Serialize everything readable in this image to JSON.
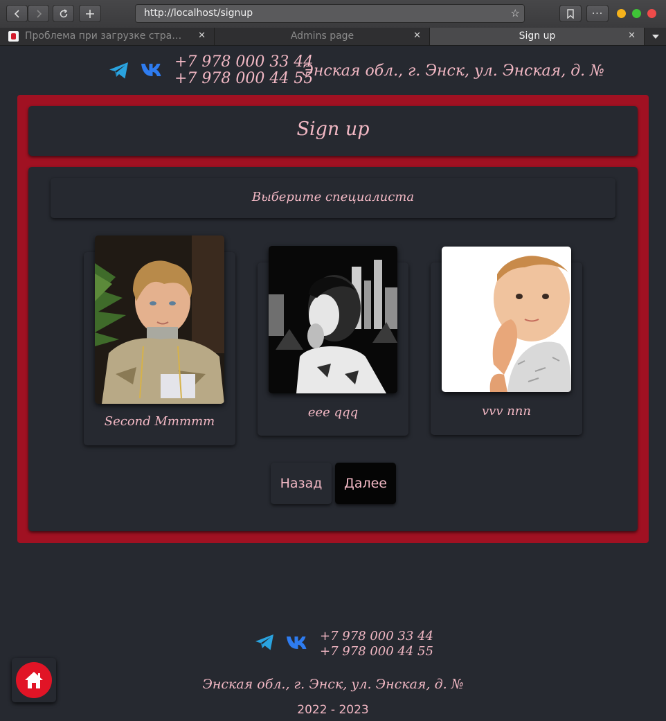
{
  "browser": {
    "url": "http://localhost/signup",
    "tabs": [
      {
        "title": "Проблема при загрузке стра…",
        "active": false
      },
      {
        "title": "Admins page",
        "active": false
      },
      {
        "title": "Sign up",
        "active": true
      }
    ],
    "close_glyph": "✕"
  },
  "header": {
    "phones": [
      "+7 978 000 33 44",
      "+7 978 000 44 55"
    ],
    "address": "Энская обл., г. Энск, ул. Энская, д. №",
    "icons": [
      "telegram-icon",
      "vk-icon"
    ]
  },
  "page": {
    "title": "Sign up",
    "choose_label": "Выберите специалиста",
    "specialists": [
      {
        "name": "Second Mmmmm",
        "photo": "boy-photo"
      },
      {
        "name": "eee qqq",
        "photo": "child-bw-photo"
      },
      {
        "name": "vvv nnn",
        "photo": "baby-photo"
      }
    ],
    "back_label": "Назад",
    "next_label": "Далее"
  },
  "footer": {
    "phones": [
      "+7 978 000 33 44",
      "+7 978 000 44 55"
    ],
    "address": "Энская обл., г. Энск, ул. Энская, д. №",
    "years": "2022 - 2023",
    "home_icon": "home-icon"
  },
  "colors": {
    "background": "#262930",
    "frame": "#a01122",
    "text": "#f2b8c4",
    "telegram": "#2aa3df",
    "vk": "#2e7cf0",
    "home": "#e11426"
  }
}
